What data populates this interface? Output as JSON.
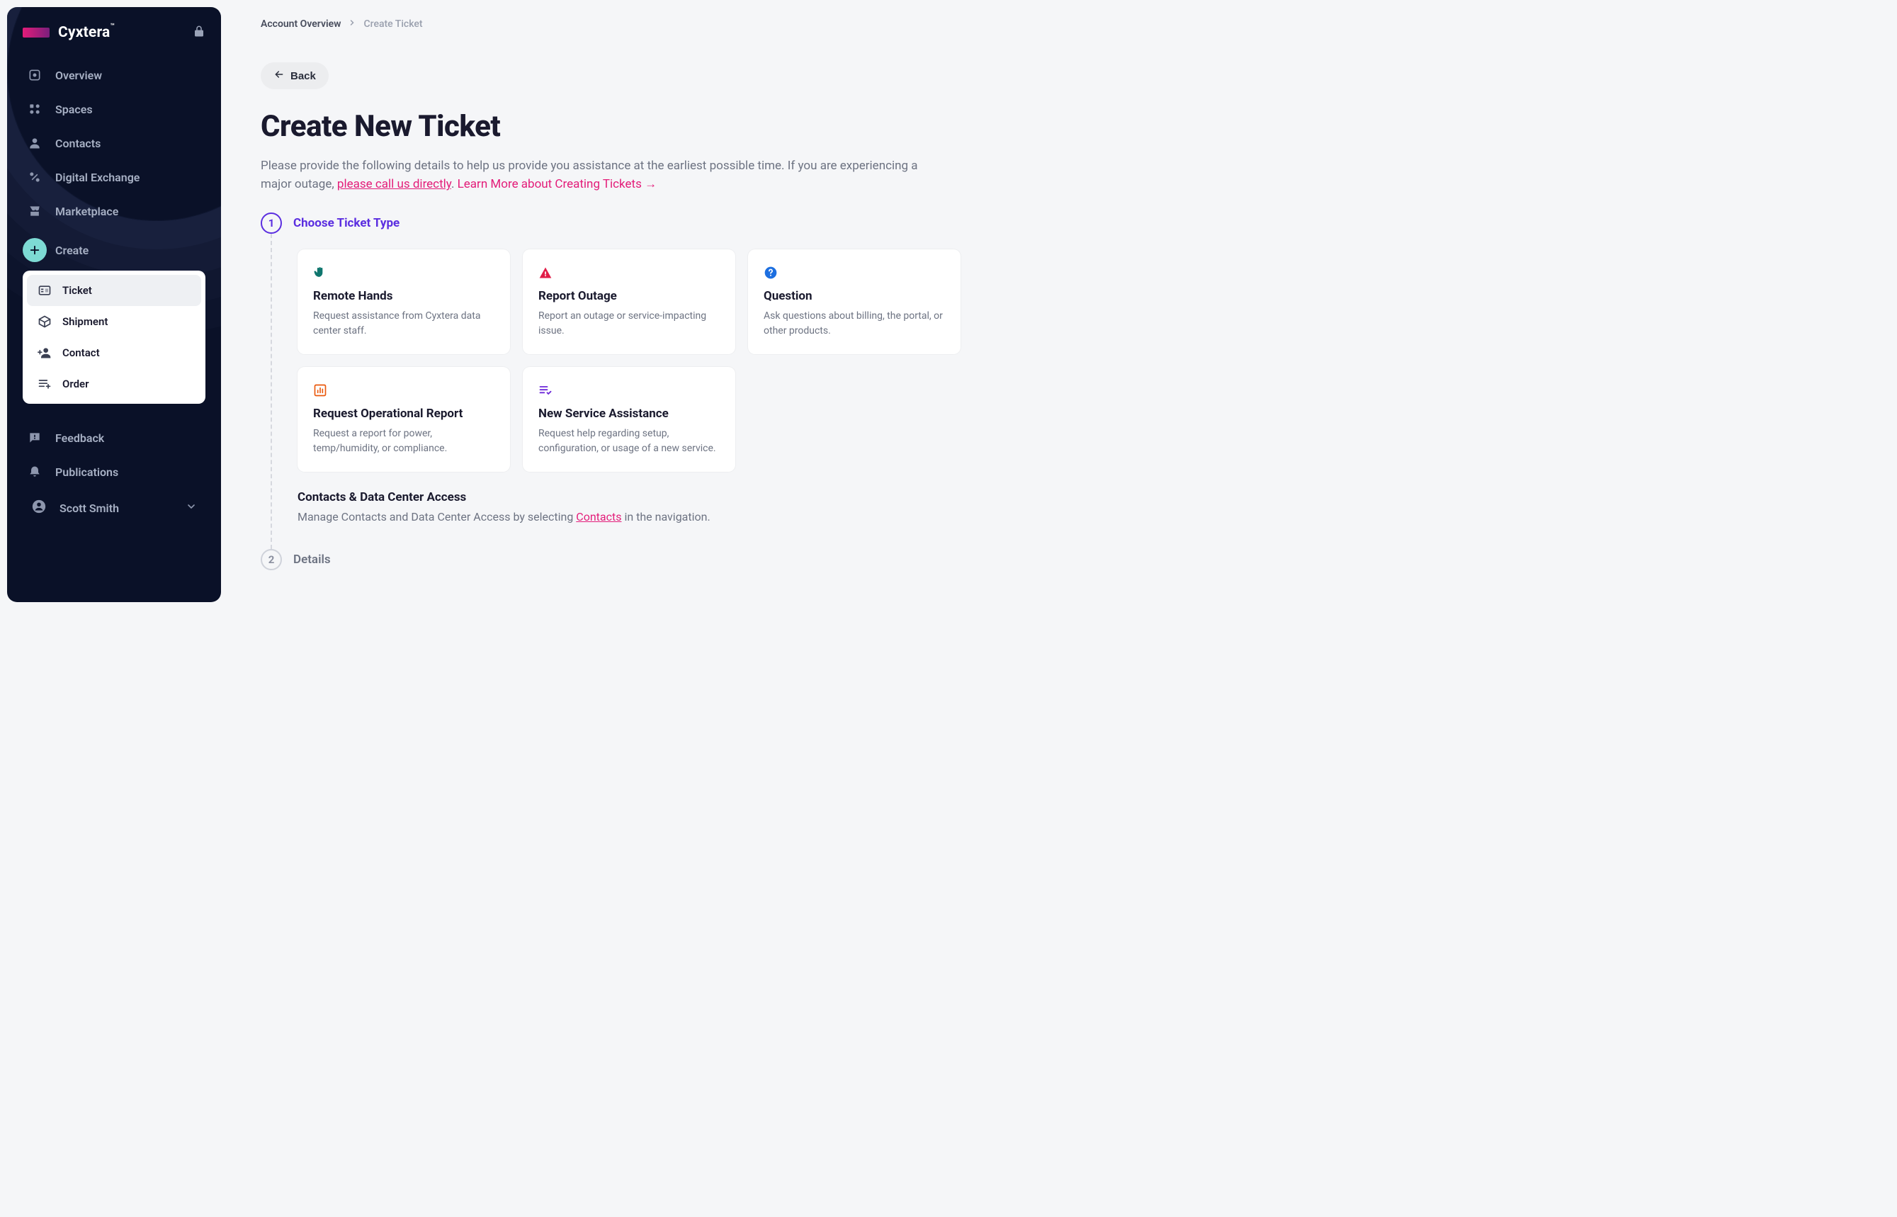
{
  "brand": {
    "name": "Cyxtera"
  },
  "sidebar": {
    "items": [
      {
        "id": "overview",
        "label": "Overview"
      },
      {
        "id": "spaces",
        "label": "Spaces"
      },
      {
        "id": "contacts",
        "label": "Contacts"
      },
      {
        "id": "digital-exchange",
        "label": "Digital Exchange"
      },
      {
        "id": "marketplace",
        "label": "Marketplace"
      },
      {
        "id": "create",
        "label": "Create"
      }
    ],
    "create_sub": [
      {
        "id": "ticket",
        "label": "Ticket"
      },
      {
        "id": "shipment",
        "label": "Shipment"
      },
      {
        "id": "contact",
        "label": "Contact"
      },
      {
        "id": "order",
        "label": "Order"
      }
    ],
    "bottom": [
      {
        "id": "feedback",
        "label": "Feedback"
      },
      {
        "id": "publications",
        "label": "Publications"
      }
    ],
    "user": {
      "name": "Scott Smith"
    }
  },
  "breadcrumb": {
    "parent": "Account Overview",
    "current": "Create Ticket"
  },
  "back_label": "Back",
  "title": "Create New Ticket",
  "intro": {
    "pre": "Please provide the following details to help us provide you assistance at the earliest possible time. If you are experiencing a major outage, ",
    "call": "please call us directly",
    "mid": ". ",
    "learn": "Learn More about Creating Tickets →"
  },
  "steps": {
    "s1": {
      "num": "1",
      "label": "Choose Ticket Type"
    },
    "s2": {
      "num": "2",
      "label": "Details"
    }
  },
  "cards": [
    {
      "id": "remote-hands",
      "title": "Remote Hands",
      "desc": "Request assistance from Cyxtera data center staff."
    },
    {
      "id": "report-outage",
      "title": "Report Outage",
      "desc": "Report an outage or service-impacting issue."
    },
    {
      "id": "question",
      "title": "Question",
      "desc": "Ask questions about billing, the portal, or other products."
    },
    {
      "id": "operational-report",
      "title": "Request Operational Report",
      "desc": "Request a report for power, temp/humidity, or compliance."
    },
    {
      "id": "new-service-assistance",
      "title": "New Service Assistance",
      "desc": "Request help regarding setup, configuration, or usage of a new service."
    }
  ],
  "cdca": {
    "title": "Contacts & Data Center Access",
    "pre": "Manage Contacts and Data Center Access by selecting ",
    "link": "Contacts",
    "post": " in the navigation."
  }
}
